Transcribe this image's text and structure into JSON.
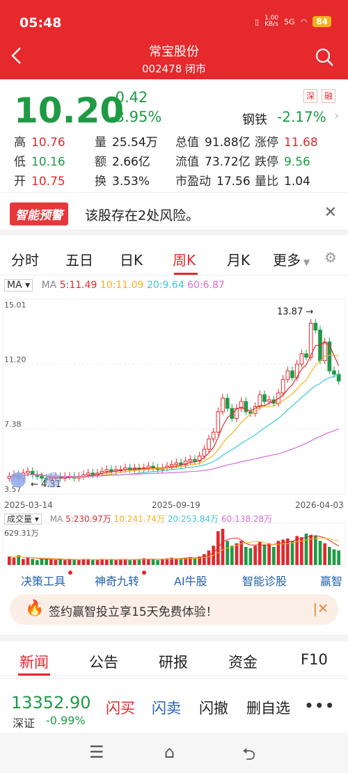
{
  "status": {
    "time": "05:48",
    "speed": "1.00\nKB/s",
    "net": "5G",
    "battery": "84"
  },
  "header": {
    "title": "常宝股份",
    "subtitle": "002478 闭市"
  },
  "quote": {
    "price": "10.20",
    "change": "-0.42",
    "change_pct": "-3.95%",
    "tag1": "深",
    "tag2": "融",
    "industry": "钢铁",
    "industry_chg": "-2.17%",
    "rows": [
      [
        {
          "k": "高",
          "v": "10.76",
          "c": "red"
        },
        {
          "k": "量",
          "v": "25.54万",
          "c": ""
        },
        {
          "k": "总值",
          "v": "91.88亿",
          "c": ""
        },
        {
          "k": "涨停",
          "v": "11.68",
          "c": "red"
        }
      ],
      [
        {
          "k": "低",
          "v": "10.16",
          "c": "green"
        },
        {
          "k": "额",
          "v": "2.66亿",
          "c": ""
        },
        {
          "k": "流值",
          "v": "73.72亿",
          "c": ""
        },
        {
          "k": "跌停",
          "v": "9.56",
          "c": "green"
        }
      ],
      [
        {
          "k": "开",
          "v": "10.75",
          "c": "red"
        },
        {
          "k": "换",
          "v": "3.53%",
          "c": ""
        },
        {
          "k": "市盈动",
          "v": "17.56",
          "c": ""
        },
        {
          "k": "量比",
          "v": "1.04",
          "c": ""
        }
      ]
    ]
  },
  "alert": {
    "badge": "智能预警",
    "text": "该股存在2处风险。"
  },
  "tabs": [
    "分时",
    "五日",
    "日K",
    "周K",
    "月K",
    "更多"
  ],
  "ma": {
    "label": "MA",
    "title": "MA",
    "ma5": "5:11.49",
    "ma10": "10:11.09",
    "ma20": "20:9.64",
    "ma60": "60:6.87"
  },
  "chart_data": {
    "type": "candlestick",
    "y_ticks": [
      "15.01",
      "11.20",
      "7.38",
      "3.57"
    ],
    "x_ticks": [
      "2025-03-14",
      "2025-09-19",
      "2026-04-03"
    ],
    "high_label": "13.87 →",
    "low_label": "← 4.31",
    "colors": {
      "up": "#e0292e",
      "down": "#1e9a45",
      "ma5": "#e0292e",
      "ma10": "#f2b21c",
      "ma20": "#3cc7d8",
      "ma60": "#d86bd8"
    },
    "close": [
      4.6,
      4.7,
      4.5,
      4.8,
      4.9,
      4.7,
      4.6,
      4.5,
      4.4,
      4.5,
      4.6,
      4.5,
      4.6,
      4.6,
      4.5,
      4.6,
      4.7,
      4.8,
      4.7,
      4.8,
      4.9,
      5.0,
      4.9,
      5.0,
      5.0,
      5.1,
      5.0,
      5.1,
      5.0,
      5.1,
      5.2,
      5.1,
      5.0,
      5.1,
      5.2,
      5.3,
      5.4,
      5.3,
      5.5,
      5.6,
      5.5,
      5.8,
      6.2,
      6.8,
      7.2,
      8.4,
      9.2,
      8.6,
      8.0,
      8.6,
      9.0,
      8.4,
      8.3,
      8.7,
      9.4,
      9.0,
      9.1,
      8.9,
      9.5,
      10.3,
      10.8,
      10.4,
      11.2,
      11.8,
      11.6,
      13.6,
      13.2,
      11.4,
      12.5,
      10.8,
      10.6,
      10.2
    ]
  },
  "volume": {
    "label": "成交量",
    "title": "MA",
    "ma5": "5:230.97万",
    "ma10": "10:241.74万",
    "ma20": "20:253.84万",
    "ma60": "60:138.28万",
    "max_label": "629.31万",
    "values": [
      70,
      60,
      80,
      50,
      60,
      50,
      40,
      50,
      50,
      45,
      40,
      50,
      40,
      50,
      45,
      40,
      50,
      50,
      40,
      40,
      50,
      45,
      50,
      40,
      45,
      50,
      40,
      45,
      50,
      55,
      50,
      45,
      40,
      50,
      55,
      60,
      55,
      50,
      60,
      65,
      60,
      70,
      90,
      120,
      160,
      280,
      300,
      200,
      160,
      180,
      200,
      150,
      140,
      160,
      190,
      170,
      180,
      150,
      200,
      210,
      220,
      200,
      240,
      230,
      260,
      250,
      240,
      200,
      180,
      150,
      130,
      120
    ]
  },
  "tools": [
    "决策工具",
    "神奇九转",
    "AI牛股",
    "智能诊股",
    "赢智"
  ],
  "promo": {
    "text": "签约赢智投立享15天免费体验！"
  },
  "news_tabs": [
    "新闻",
    "公告",
    "研报",
    "资金",
    "F10"
  ],
  "bottom": {
    "index_value": "13352.90",
    "index_name": "深证",
    "index_chg": "-0.99%",
    "buy": "闪买",
    "sell": "闪卖",
    "cancel": "闪撤",
    "remove": "删自选",
    "more": "•••"
  }
}
